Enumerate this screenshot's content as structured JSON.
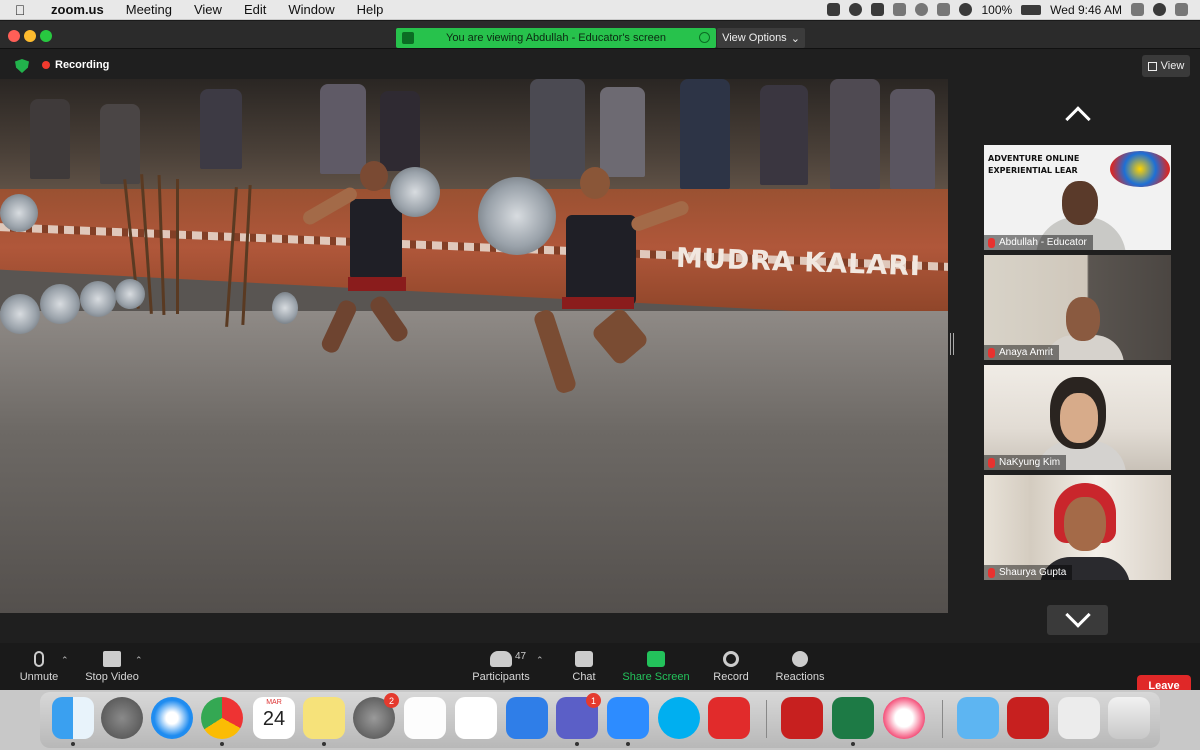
{
  "menubar": {
    "app_name": "zoom.us",
    "menus": [
      "Meeting",
      "View",
      "Edit",
      "Window",
      "Help"
    ],
    "battery": "100%",
    "clock": "Wed 9:46 AM"
  },
  "titlebar": {
    "viewing_banner": "You are viewing Abdullah - Educator's screen",
    "view_options": "View Options"
  },
  "status": {
    "recording": "Recording",
    "view_button": "View"
  },
  "shared_screen": {
    "wall_text": "MUDRA KALARI"
  },
  "gallery": {
    "tiles": [
      {
        "name": "Abdullah - Educator",
        "brand_line1": "ADVENTURE ONLINE",
        "brand_line2": "EXPERIENTIAL LEAR",
        "logo_text": "ADVENTURE"
      },
      {
        "name": "Anaya Amrit"
      },
      {
        "name": "NaKyung Kim"
      },
      {
        "name": "Shaurya Gupta"
      }
    ]
  },
  "toolbar": {
    "unmute": "Unmute",
    "stop_video": "Stop Video",
    "participants": "Participants",
    "participant_count": "47",
    "chat": "Chat",
    "share_screen": "Share Screen",
    "record": "Record",
    "reactions": "Reactions",
    "leave": "Leave"
  },
  "dock": {
    "calendar_month": "MAR",
    "calendar_day": "24",
    "system_prefs_badge": "2",
    "teams_badge": "1"
  },
  "colors": {
    "share_green": "#23c25b",
    "leave_red": "#e02828",
    "banner_green": "#27c24c",
    "recording_red": "#f03a2e"
  }
}
